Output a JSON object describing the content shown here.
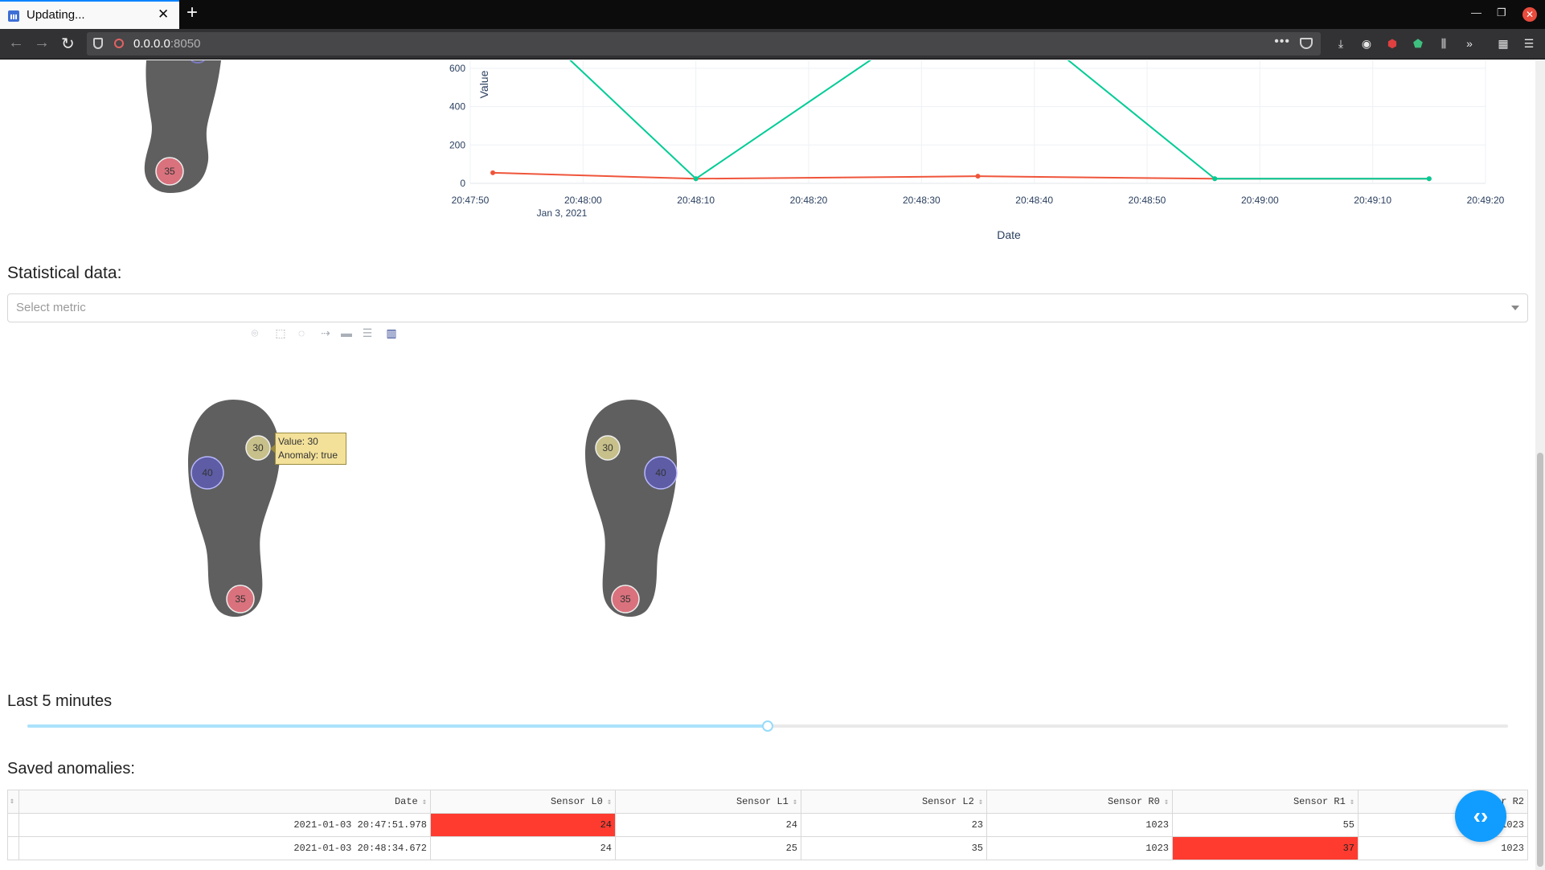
{
  "browser": {
    "tab_title": "Updating...",
    "url_host": "0.0.0.0",
    "url_port": ":8050"
  },
  "timeseries": {
    "ylabel": "Value",
    "xlabel": "Date",
    "y_ticks": [
      "600",
      "400",
      "200",
      "0"
    ],
    "x_ticks": [
      "20:47:50",
      "20:48:00",
      "20:48:10",
      "20:48:20",
      "20:48:30",
      "20:48:40",
      "20:48:50",
      "20:49:00",
      "20:49:10",
      "20:49:20"
    ],
    "x_date_label": "Jan 3, 2021"
  },
  "chart_data": {
    "type": "line",
    "xlabel": "Date",
    "ylabel": "Value",
    "x_range": [
      "20:47:50",
      "20:49:20"
    ],
    "y_visible_range": [
      0,
      650
    ],
    "series": [
      {
        "color": "#ef553b",
        "x": [
          "20:47:52",
          "20:48:10",
          "20:48:35",
          "20:48:56",
          "20:49:15"
        ],
        "values": [
          55,
          24,
          37,
          24,
          24
        ]
      },
      {
        "color": "#00cc96",
        "x": [
          "20:47:52",
          "20:48:10",
          "20:48:35",
          "20:48:56",
          "20:49:15"
        ],
        "values": [
          1023,
          24,
          1023,
          24,
          24
        ]
      }
    ]
  },
  "statistical": {
    "heading": "Statistical data:",
    "select_placeholder": "Select metric"
  },
  "top_foot": {
    "sensor_value": "35"
  },
  "feet": {
    "left": {
      "s0": "30",
      "s1": "40",
      "s2": "35"
    },
    "right": {
      "s0": "30",
      "s1": "40",
      "s2": "35"
    }
  },
  "tooltip": {
    "line1": "Value: 30",
    "line2": "Anomaly: true"
  },
  "slider": {
    "label": "Last 5 minutes",
    "fraction": 0.5
  },
  "anomalies": {
    "heading": "Saved anomalies:",
    "columns": [
      "Date",
      "Sensor L0",
      "Sensor L1",
      "Sensor L2",
      "Sensor R0",
      "Sensor R1",
      "r R2"
    ],
    "rows": [
      [
        "2021-01-03 20:47:51.978",
        "24",
        "24",
        "23",
        "1023",
        "55",
        "1023"
      ],
      [
        "2021-01-03 20:48:34.672",
        "24",
        "25",
        "35",
        "1023",
        "37",
        "1023"
      ]
    ]
  },
  "colors": {
    "accent": "#119dff",
    "anomaly": "#ff3b30",
    "sensor_pink": "#d9727d",
    "sensor_purple": "#5d5ca5",
    "sensor_tan": "#c8c08a",
    "foot": "#5f5f5f"
  }
}
